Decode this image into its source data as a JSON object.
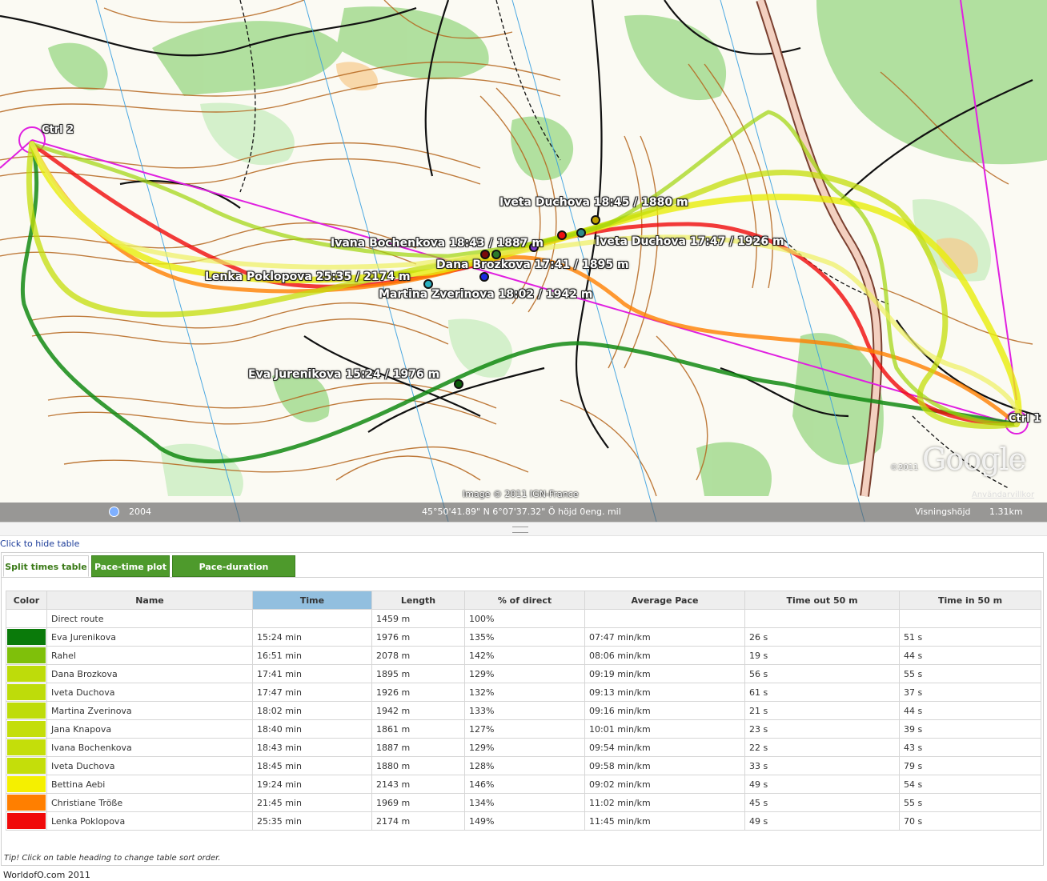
{
  "map": {
    "controls": [
      {
        "id": "ctrl2",
        "label": "Ctrl 2"
      },
      {
        "id": "ctrl1",
        "label": "Ctrl 1"
      }
    ],
    "runner_labels": {
      "iveta_a": "Iveta Duchova 18:45 / 1880 m",
      "iveta_b": "Iveta Duchova 17:47 / 1926 m",
      "ivana": "Ivana Bochenkova 18:43 / 1887 m",
      "dana": "Dana Brozkova 17:41 / 1895 m",
      "lenka": "Lenka Poklopova 25:35 / 2174 m",
      "martina": "Martina Zverinova 18:02 / 1942 m",
      "eva": "Eva Jurenikova 15:24 / 1976 m"
    },
    "image_credit": "Image © 2011 IGN-France",
    "google_logo": "Google",
    "google_copyright": "©2011",
    "terms_link": "Användarvillkor",
    "statusbar": {
      "year": "2004",
      "coordinates": "45°50'41.89\" N    6°07'37.32\" Ö  höjd    0eng. mil",
      "view_height_label": "Visningshöjd",
      "view_height_value": "1.31km"
    }
  },
  "hide_table_link": "Click to hide table",
  "tabs": [
    {
      "label": "Split times table",
      "active": true
    },
    {
      "label": "Pace-time plot",
      "active": false
    },
    {
      "label": "Pace-duration histogram",
      "active": false
    }
  ],
  "table": {
    "headers": [
      "Color",
      "Name",
      "Time",
      "Length",
      "% of direct",
      "Average Pace",
      "Time out 50 m",
      "Time in 50 m"
    ],
    "sorted_column": "Time",
    "rows": [
      {
        "color": "#ffffff",
        "name": "Direct route",
        "time": "",
        "length": "1459 m",
        "pct": "100%",
        "pace": "",
        "out": "",
        "in": ""
      },
      {
        "color": "#0a7a0a",
        "name": "Eva Jurenikova",
        "time": "15:24 min",
        "length": "1976 m",
        "pct": "135%",
        "pace": "07:47 min/km",
        "out": "26 s",
        "in": "51 s"
      },
      {
        "color": "#7fc00a",
        "name": "Rahel",
        "time": "16:51 min",
        "length": "2078 m",
        "pct": "142%",
        "pace": "08:06 min/km",
        "out": "19 s",
        "in": "44 s"
      },
      {
        "color": "#bedc0a",
        "name": "Dana Brozkova",
        "time": "17:41 min",
        "length": "1895 m",
        "pct": "129%",
        "pace": "09:19 min/km",
        "out": "56 s",
        "in": "55 s"
      },
      {
        "color": "#bedc0a",
        "name": "Iveta Duchova",
        "time": "17:47 min",
        "length": "1926 m",
        "pct": "132%",
        "pace": "09:13 min/km",
        "out": "61 s",
        "in": "37 s"
      },
      {
        "color": "#bedc0a",
        "name": "Martina Zverinova",
        "time": "18:02 min",
        "length": "1942 m",
        "pct": "133%",
        "pace": "09:16 min/km",
        "out": "21 s",
        "in": "44 s"
      },
      {
        "color": "#c4de0a",
        "name": "Jana Knapova",
        "time": "18:40 min",
        "length": "1861 m",
        "pct": "127%",
        "pace": "10:01 min/km",
        "out": "23 s",
        "in": "39 s"
      },
      {
        "color": "#c4de0a",
        "name": "Ivana Bochenkova",
        "time": "18:43 min",
        "length": "1887 m",
        "pct": "129%",
        "pace": "09:54 min/km",
        "out": "22 s",
        "in": "43 s"
      },
      {
        "color": "#c4de0a",
        "name": "Iveta Duchova",
        "time": "18:45 min",
        "length": "1880 m",
        "pct": "128%",
        "pace": "09:58 min/km",
        "out": "33 s",
        "in": "79 s"
      },
      {
        "color": "#f5f000",
        "name": "Bettina Aebi",
        "time": "19:24 min",
        "length": "2143 m",
        "pct": "146%",
        "pace": "09:02 min/km",
        "out": "49 s",
        "in": "54 s"
      },
      {
        "color": "#ff7f00",
        "name": "Christiane Tröße",
        "time": "21:45 min",
        "length": "1969 m",
        "pct": "134%",
        "pace": "11:02 min/km",
        "out": "45 s",
        "in": "55 s"
      },
      {
        "color": "#f00a0a",
        "name": "Lenka Poklopova",
        "time": "25:35 min",
        "length": "2174 m",
        "pct": "149%",
        "pace": "11:45 min/km",
        "out": "49 s",
        "in": "70 s"
      }
    ]
  },
  "tip": "Tip! Click on table heading to change table sort order.",
  "footer": "WorldofO.com 2011"
}
